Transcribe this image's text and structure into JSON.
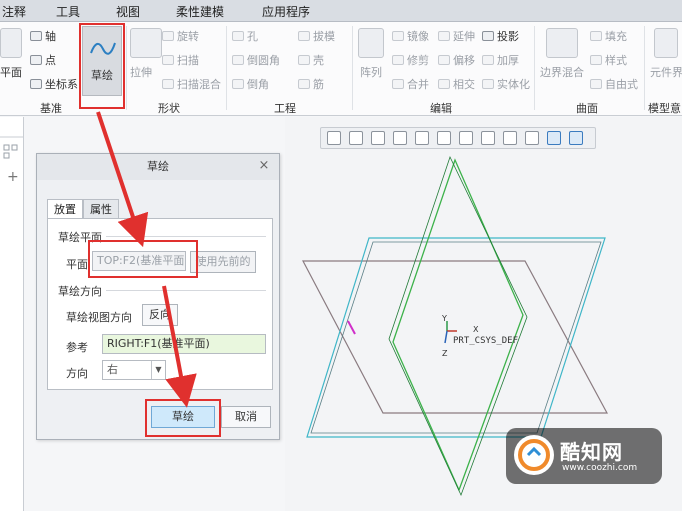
{
  "menubar": {
    "items": [
      "注释",
      "工具",
      "视图",
      "柔性建模",
      "应用程序"
    ]
  },
  "ribbon": {
    "datum": {
      "plane": "平面",
      "axis": "轴",
      "point": "点",
      "csys": "坐标系",
      "group": "基准"
    },
    "sketch": {
      "label": "草绘"
    },
    "shapes": {
      "extrude": "拉伸",
      "revolve": "旋转",
      "sweep": "扫描",
      "swept_blend": "扫描混合",
      "group": "形状"
    },
    "engineering": {
      "hole": "孔",
      "round": "倒圆角",
      "chamfer": "倒角",
      "draft": "拔模",
      "shell": "壳",
      "rib": "筋",
      "group": "工程"
    },
    "editing": {
      "pattern": "阵列",
      "mirror": "镜像",
      "trim": "修剪",
      "merge": "合并",
      "extend": "延伸",
      "offset": "偏移",
      "intersect": "相交",
      "project": "投影",
      "thicken": "加厚",
      "solidify": "实体化",
      "group": "编辑"
    },
    "surfaces": {
      "boundary_blend": "边界混合",
      "fill": "填充",
      "style": "样式",
      "freestyle": "自由式",
      "group": "曲面"
    },
    "model_intent": {
      "component_interface": "元件界",
      "group": "模型意图"
    }
  },
  "dialog": {
    "title": "草绘",
    "tabs": [
      "放置",
      "属性"
    ],
    "plane_section": "草绘平面",
    "plane_label": "平面",
    "plane_value": "TOP:F2(基准平面)",
    "use_prev_label": "使用先前的",
    "orientation_section": "草绘方向",
    "view_dir_label": "草绘视图方向",
    "flip_label": "反向",
    "reference_label": "参考",
    "reference_value": "RIGHT:F1(基准平面)",
    "orientation_label": "方向",
    "orientation_value": "右",
    "ok_label": "草绘",
    "cancel_label": "取消"
  },
  "canvas": {
    "csys_label": "PRT_CSYS_DEF",
    "axis_x": "X",
    "axis_y": "Y",
    "axis_z": "Z"
  },
  "watermark": {
    "title": "酷知网",
    "url": "www.coozhi.com"
  },
  "colors": {
    "highlight": "#e0302e",
    "green_plane": "#3cb24a",
    "cyan_plane": "#3fb6c8",
    "gray_plane": "#8a7b80"
  }
}
